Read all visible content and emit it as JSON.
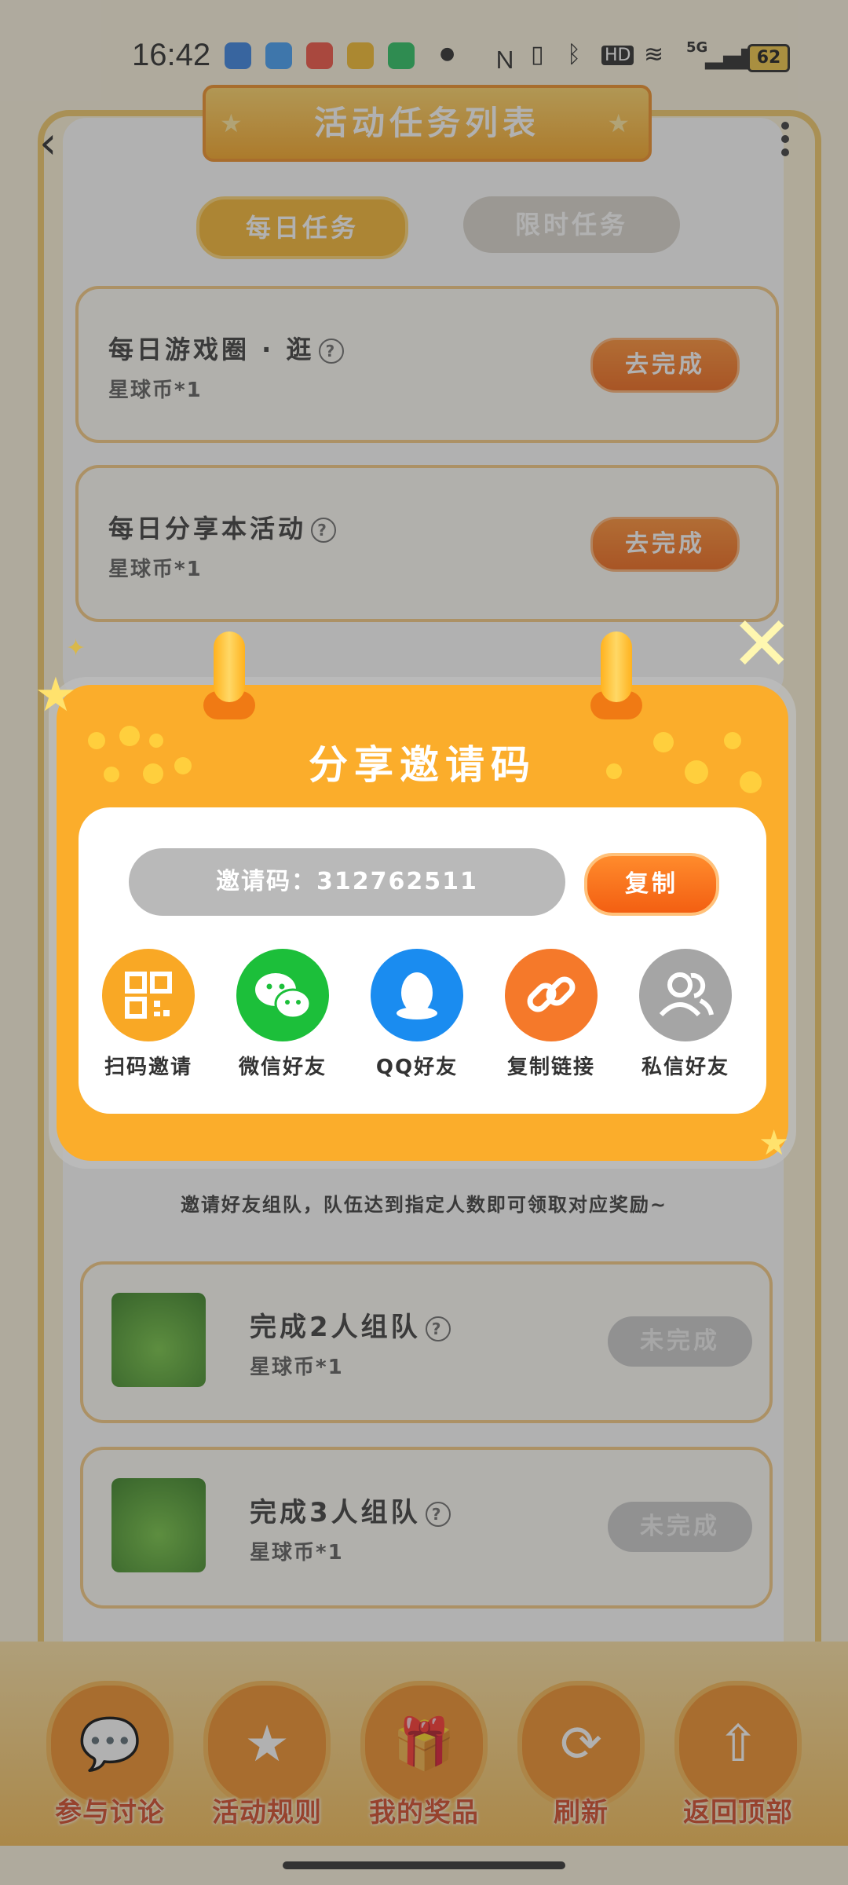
{
  "status_bar": {
    "time": "16:42",
    "battery": "62",
    "network": "5G"
  },
  "header": {
    "title": "活动任务列表"
  },
  "tabs": [
    {
      "label": "每日任务",
      "active": true
    },
    {
      "label": "限时任务",
      "active": false
    }
  ],
  "daily_tasks": [
    {
      "title": "每日游戏圈 · 逛",
      "reward": "星球币*1",
      "button": "去完成"
    },
    {
      "title": "每日分享本活动",
      "reward": "星球币*1",
      "button": "去完成"
    }
  ],
  "team_section": {
    "note": "邀请好友组队，队伍达到指定人数即可领取对应奖励~",
    "tasks": [
      {
        "title": "完成2人组队",
        "reward": "星球币*1",
        "button": "未完成"
      },
      {
        "title": "完成3人组队",
        "reward": "星球币*1",
        "button": "未完成"
      }
    ]
  },
  "bottom_nav": [
    {
      "label": "参与讨论",
      "icon": "discussion-icon"
    },
    {
      "label": "活动规则",
      "icon": "star-rules-icon"
    },
    {
      "label": "我的奖品",
      "icon": "gift-icon"
    },
    {
      "label": "刷新",
      "icon": "refresh-icon"
    },
    {
      "label": "返回顶部",
      "icon": "upload-arrow-icon"
    }
  ],
  "modal": {
    "title": "分享邀请码",
    "code_label": "邀请码：312762511",
    "copy_button": "复制",
    "share_options": [
      {
        "label": "扫码邀请",
        "icon": "qr-code-icon",
        "color": "#f9a825"
      },
      {
        "label": "微信好友",
        "icon": "wechat-icon",
        "color": "#1cbf3a"
      },
      {
        "label": "QQ好友",
        "icon": "qq-penguin-icon",
        "color": "#1a8cf0"
      },
      {
        "label": "复制链接",
        "icon": "link-icon",
        "color": "#f5792a"
      },
      {
        "label": "私信好友",
        "icon": "friends-icon",
        "color": "#a5a5a5"
      }
    ]
  },
  "colors": {
    "accent_orange": "#f0610f",
    "modal_bg": "#fbad2b"
  }
}
